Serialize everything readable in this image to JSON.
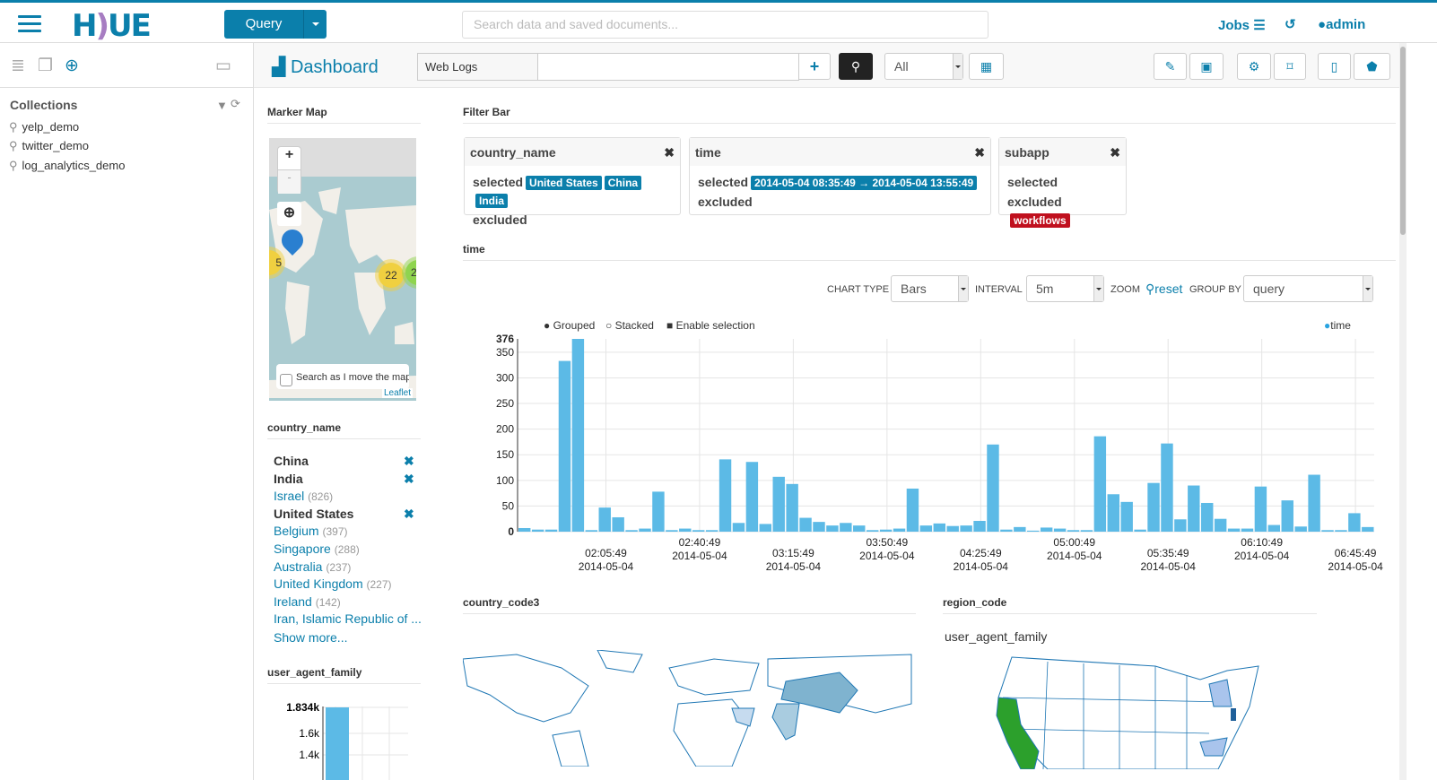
{
  "topbar": {
    "logo": "HUE",
    "query_button": "Query",
    "search_placeholder": "Search data and saved documents...",
    "jobs": "Jobs",
    "user": "admin"
  },
  "sidebar": {
    "collections_title": "Collections",
    "collections": [
      "yelp_demo",
      "twitter_demo",
      "log_analytics_demo"
    ]
  },
  "header": {
    "title": "Dashboard",
    "collection": "Web Logs",
    "query_value": "",
    "filter_select": "All"
  },
  "widgets": {
    "marker_map": "Marker Map",
    "filter_bar": "Filter Bar",
    "time": "time",
    "country_code3": "country_code3",
    "region_code": "region_code",
    "country_name": "country_name",
    "user_agent_family": "user_agent_family"
  },
  "map": {
    "zoom_in": "+",
    "zoom_out": "-",
    "cluster_left": "5",
    "cluster_mid": "22",
    "cluster_right": "2",
    "search_move": "Search as I move the map",
    "attribution": "Leaflet"
  },
  "filters": [
    {
      "field": "country_name",
      "selected_label": "selected",
      "selected": [
        "United States",
        "China",
        "India"
      ],
      "excluded_label": "excluded",
      "excluded": []
    },
    {
      "field": "time",
      "selected_label": "selected",
      "selected": [
        "2014-05-04  08:35:49 → 2014-05-04  13:55:49"
      ],
      "excluded_label": "excluded",
      "excluded": []
    },
    {
      "field": "subapp",
      "selected_label": "selected",
      "selected": [],
      "excluded_label": "excluded",
      "excluded": [
        "workflows"
      ]
    }
  ],
  "chart_controls": {
    "chart_type_label": "CHART TYPE",
    "chart_type": "Bars",
    "interval_label": "INTERVAL",
    "interval": "5m",
    "zoom_label": "ZOOM",
    "reset": "reset",
    "group_by_label": "GROUP BY",
    "group_by": "query",
    "grouped": "Grouped",
    "stacked": "Stacked",
    "enable_selection": "Enable selection"
  },
  "country_facet": [
    {
      "label": "China",
      "selected": true,
      "count": ""
    },
    {
      "label": "India",
      "selected": true,
      "count": ""
    },
    {
      "label": "Israel",
      "selected": false,
      "count": "(826)"
    },
    {
      "label": "United States",
      "selected": true,
      "count": ""
    },
    {
      "label": "Belgium",
      "selected": false,
      "count": "(397)"
    },
    {
      "label": "Singapore",
      "selected": false,
      "count": "(288)"
    },
    {
      "label": "Australia",
      "selected": false,
      "count": "(237)"
    },
    {
      "label": "United Kingdom",
      "selected": false,
      "count": "(227)"
    },
    {
      "label": "Ireland",
      "selected": false,
      "count": "(142)"
    },
    {
      "label": "Iran, Islamic Republic of ...",
      "selected": false,
      "count": ""
    }
  ],
  "show_more": "Show more...",
  "colors": {
    "accent": "#0b7fab",
    "bar": "#5cbae6",
    "excluded": "#c0101e",
    "map_fill": "#2ca02c"
  },
  "chart_data": [
    {
      "type": "bar",
      "legend": [
        "time"
      ],
      "legend_placement": "top-right",
      "ylim": [
        0,
        376
      ],
      "yticks": [
        "0",
        "50",
        "100",
        "150",
        "200",
        "250",
        "300",
        "350",
        "376"
      ],
      "xtick_labels": [
        [
          "02:05:49",
          "2014-05-04"
        ],
        [
          "02:40:49",
          "2014-05-04"
        ],
        [
          "03:15:49",
          "2014-05-04"
        ],
        [
          "03:50:49",
          "2014-05-04"
        ],
        [
          "04:25:49",
          "2014-05-04"
        ],
        [
          "05:00:49",
          "2014-05-04"
        ],
        [
          "05:35:49",
          "2014-05-04"
        ],
        [
          "06:10:49",
          "2014-05-04"
        ],
        [
          "06:45:49",
          "2014-05-04"
        ]
      ],
      "grid": true,
      "values": [
        7,
        4,
        4,
        333,
        376,
        3,
        47,
        28,
        3,
        6,
        78,
        3,
        6,
        3,
        3,
        141,
        17,
        136,
        15,
        107,
        93,
        27,
        19,
        12,
        17,
        12,
        3,
        4,
        6,
        84,
        12,
        16,
        11,
        12,
        21,
        170,
        4,
        9,
        2,
        8,
        6,
        3,
        3,
        186,
        73,
        58,
        4,
        95,
        172,
        24,
        90,
        56,
        25,
        6,
        6,
        88,
        13,
        61,
        10,
        111,
        3,
        3,
        36,
        9
      ]
    },
    {
      "type": "bar",
      "yticks": [
        "1.4k",
        "1.6k",
        "1.834k"
      ],
      "values": [
        1834
      ],
      "grid": true
    }
  ]
}
